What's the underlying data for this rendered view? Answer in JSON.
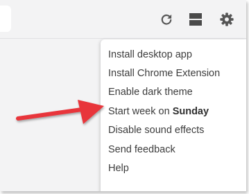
{
  "toolbar": {
    "icons": [
      "refresh-icon",
      "layout-icon",
      "gear-icon"
    ]
  },
  "menu": {
    "items": [
      {
        "label": "Install desktop app"
      },
      {
        "label": "Install Chrome Extension"
      },
      {
        "label": "Enable dark theme"
      },
      {
        "label_prefix": "Start week on ",
        "label_bold": "Sunday"
      },
      {
        "label": "Disable sound effects"
      },
      {
        "label": "Send feedback"
      },
      {
        "label": "Help"
      }
    ]
  },
  "colors": {
    "arrow": "#e8363b",
    "background": "#f3f3f4",
    "menu_text": "#3c3c3c"
  }
}
